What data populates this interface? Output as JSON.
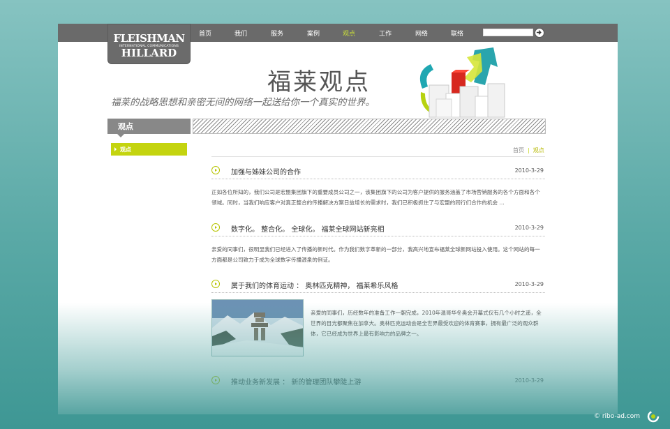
{
  "logo": {
    "line1": "FLEISHMAN",
    "line2": "INTERNATIONAL COMMUNICATIONS",
    "line3": "HILLARD"
  },
  "nav": {
    "items": [
      {
        "label": "首页"
      },
      {
        "label": "我们"
      },
      {
        "label": "服务"
      },
      {
        "label": "案例"
      },
      {
        "label": "观点"
      },
      {
        "label": "工作"
      },
      {
        "label": "网络"
      },
      {
        "label": "联络"
      }
    ],
    "active": "观点"
  },
  "search": {
    "placeholder": ""
  },
  "banner": {
    "title": "福莱观点",
    "slogan": "福莱的战略思想和亲密无间的网络一起送给你一个真实的世界。"
  },
  "sidebar": {
    "heading": "观点",
    "items": [
      {
        "label": "观点"
      }
    ]
  },
  "breadcrumb": {
    "home": "首页",
    "separator": "|",
    "current": "观点"
  },
  "articles": [
    {
      "title": "加强与姊妹公司的合作",
      "date": "2010-3-29",
      "body": "正如各位所知的，我们公司是宏盟集团旗下的重要成员公司之一，该集团旗下的公司为客户提供的服务涵盖了市场营销服务的各个方面和各个领域。同时，当我们响应客户对真正整合的传播解决方案日益增长的需求时，我们已积极抓住了与宏盟的同行们合作的机会 ..."
    },
    {
      "title": "数字化。 整合化。 全球化。 福莱全球网站新亮相",
      "date": "2010-3-29",
      "body": "亲爱的同事们，很明显我们已经进入了传播的新时代。作为我们数字革新的一部分，我高兴地宣布福莱全球新网站投入使用。这个网站的每一方面都是公司致力于成为全球数字传播源泉的例证。"
    },
    {
      "title": "属于我们的体育运动 ： 奥林匹克精神， 福莱希乐风格",
      "date": "2010-3-29",
      "body": "亲爱的同事们，历经数年的准备工作一朝完成，2010年温哥华冬奥会开幕式仅有几个小时之遥，全世界的目光都聚焦在加拿大。奥林匹克运动会是全世界最受欢迎的体育赛事，拥有最广泛的观众群体，它已经成为世界上最有影响力的品牌之一。"
    },
    {
      "title": "推动业务新发展 ： 新的管理团队攀陡上游",
      "date": "2010-3-29",
      "body": ""
    }
  ],
  "footer": {
    "credit": "© ribo-ad.com"
  },
  "colors": {
    "accent": "#c4d40f",
    "topbar": "#6a6a6a",
    "background": "#5aa9a6"
  },
  "icons": {
    "search": "arrow-right-circle-icon",
    "article": "arrow-circle-icon"
  }
}
